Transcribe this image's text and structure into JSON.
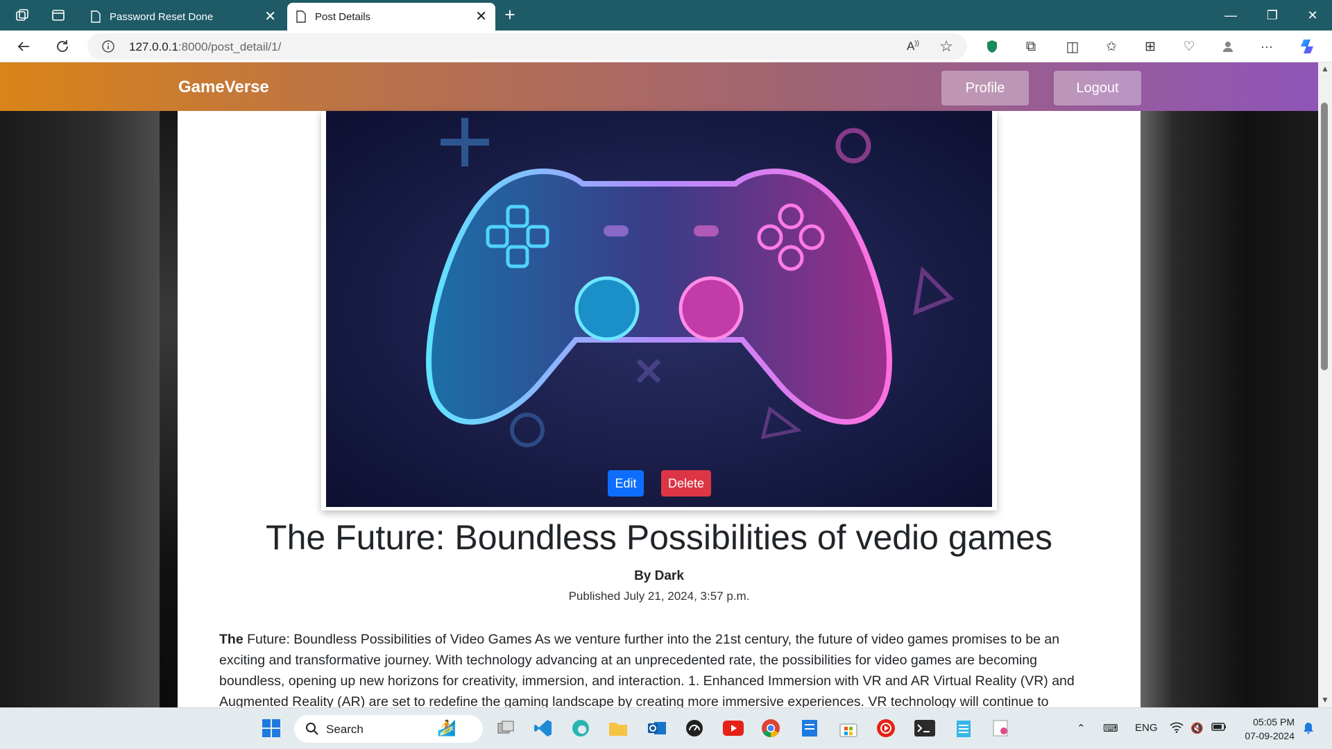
{
  "browser": {
    "tabs": [
      {
        "title": "Password Reset Done",
        "active": false
      },
      {
        "title": "Post Details",
        "active": true
      }
    ],
    "url_host": "127.0.0.1",
    "url_rest": ":8000/post_detail/1/"
  },
  "site": {
    "brand": "GameVerse",
    "nav": {
      "profile": "Profile",
      "logout": "Logout"
    }
  },
  "post": {
    "image_alt": "Neon game controller",
    "actions": {
      "edit": "Edit",
      "delete": "Delete"
    },
    "title": "The Future: Boundless Possibilities of vedio games",
    "author": "By Dark",
    "published": "Published July 21, 2024, 3:57 p.m.",
    "body_lead": "The",
    "body": "Future: Boundless Possibilities of Video Games As we venture further into the 21st century, the future of video games promises to be an exciting and transformative journey. With technology advancing at an unprecedented rate, the possibilities for video games are becoming boundless, opening up new horizons for creativity, immersion, and interaction. 1. Enhanced Immersion with VR and AR Virtual Reality (VR) and Augmented Reality (AR) are set to redefine the gaming landscape by creating more immersive experiences. VR technology will continue to"
  },
  "taskbar": {
    "search_label": "Search",
    "language": "ENG",
    "time": "05:05 PM",
    "date": "07-09-2024"
  },
  "colors": {
    "navbar_start": "#d98418",
    "navbar_end": "#8f55b8",
    "edit": "#0d6efd",
    "delete": "#dc3545",
    "tabstrip": "#1e5b66"
  }
}
